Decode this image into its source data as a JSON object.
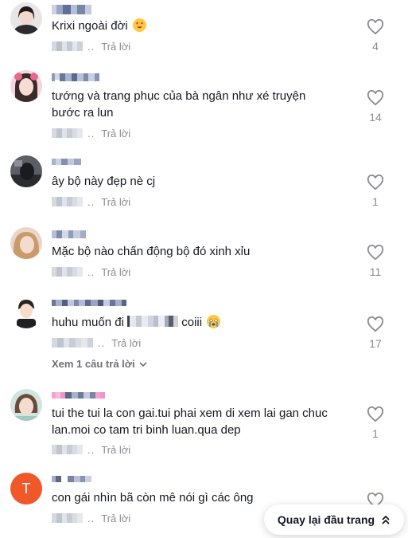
{
  "comments": [
    {
      "text": "Krixi ngoài đời",
      "reply_label": "Trả lời",
      "dots": "..",
      "likes": "4"
    },
    {
      "text": "tướng và trang phục của bà ngân như xé truyện bước ra lun",
      "reply_label": "Trả lời",
      "dots": "..",
      "likes": "14"
    },
    {
      "text": "ây bộ này đẹp nè cj",
      "reply_label": "Trả lời",
      "dots": "..",
      "likes": "1"
    },
    {
      "text": "Mặc bộ nào chấn động bộ đó xinh xỉu",
      "reply_label": "Trả lời",
      "dots": "..",
      "likes": "11"
    },
    {
      "text_start": "huhu muốn đi",
      "text_end": "coiii",
      "reply_label": "Trả lời",
      "dots": "..",
      "likes": "17"
    },
    {
      "text": "tui the tui la con gai.tui phai xem di xem lai gan chuc lan.moi co tam tri binh luan.qua dep",
      "reply_label": "Trả lời",
      "dots": "..",
      "likes": "1"
    },
    {
      "avatar_letter": "T",
      "text": "con gái nhìn bã còn mê nói gì các ông",
      "reply_label": "Trả lời",
      "dots": ".."
    }
  ],
  "view_replies": {
    "label": "Xem 1 câu trả lời"
  },
  "back_to_top": {
    "label": "Quay lại đầu trang"
  },
  "colors": {
    "avatar_t": "#f0582a",
    "muted": "#8a8b91",
    "text": "#161823"
  }
}
